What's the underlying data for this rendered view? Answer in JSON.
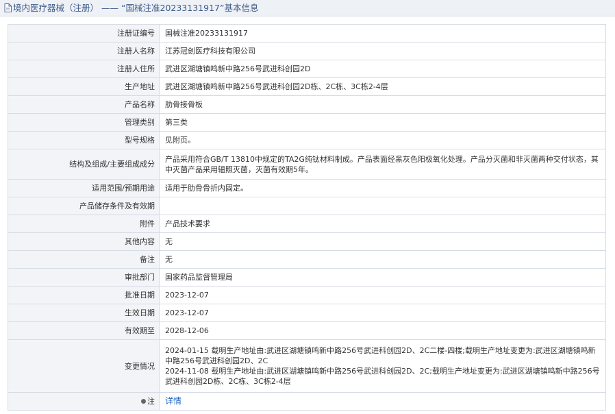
{
  "header": {
    "section": "境内医疗器械（注册）",
    "separator": "——",
    "title": "“国械注准20233131917”基本信息"
  },
  "rows": [
    {
      "label": "注册证编号",
      "value": "国械注准20233131917"
    },
    {
      "label": "注册人名称",
      "value": "江苏冠创医疗科技有限公司"
    },
    {
      "label": "注册人住所",
      "value": "武进区湖塘镇鸣新中路256号武进科创园2D"
    },
    {
      "label": "生产地址",
      "value": "武进区湖塘镇鸣新中路256号武进科创园2D栋、2C栋、3C栋2-4层"
    },
    {
      "label": "产品名称",
      "value": "肋骨接骨板"
    },
    {
      "label": "管理类别",
      "value": "第三类"
    },
    {
      "label": "型号规格",
      "value": "见附页。"
    },
    {
      "label": "结构及组成/主要组成成分",
      "value": "产品采用符合GB/T 13810中规定的TA2G纯钛材料制成。产品表面经黑灰色阳极氧化处理。产品分灭菌和非灭菌两种交付状态，其中灭菌产品采用辐照灭菌，灭菌有效期5年。"
    },
    {
      "label": "适用范围/预期用途",
      "value": "适用于肋骨骨折内固定。"
    },
    {
      "label": "产品储存条件及有效期",
      "value": ""
    },
    {
      "label": "附件",
      "value": "产品技术要求"
    },
    {
      "label": "其他内容",
      "value": "无"
    },
    {
      "label": "备注",
      "value": "无"
    },
    {
      "label": "审批部门",
      "value": "国家药品监督管理局"
    },
    {
      "label": "批准日期",
      "value": "2023-12-07"
    },
    {
      "label": "生效日期",
      "value": "2023-12-07"
    },
    {
      "label": "有效期至",
      "value": "2028-12-06"
    }
  ],
  "changes": {
    "label": "变更情况",
    "entries": [
      "2024-01-15 载明生产地址由:武进区湖塘镇鸣新中路256号武进科创园2D、2C二楼-四楼;载明生产地址变更为:武进区湖塘镇鸣新中路256号武进科创园2D、2C",
      "2024-11-08 载明生产地址由:武进区湖塘镇鸣新中路256号武进科创园2D、2C;载明生产地址变更为:武进区湖塘镇鸣新中路256号武进科创园2D栋、2C栋、3C栋2-4层"
    ]
  },
  "note": {
    "label": "注",
    "link": "详情",
    "icon": "note-dot-icon"
  }
}
